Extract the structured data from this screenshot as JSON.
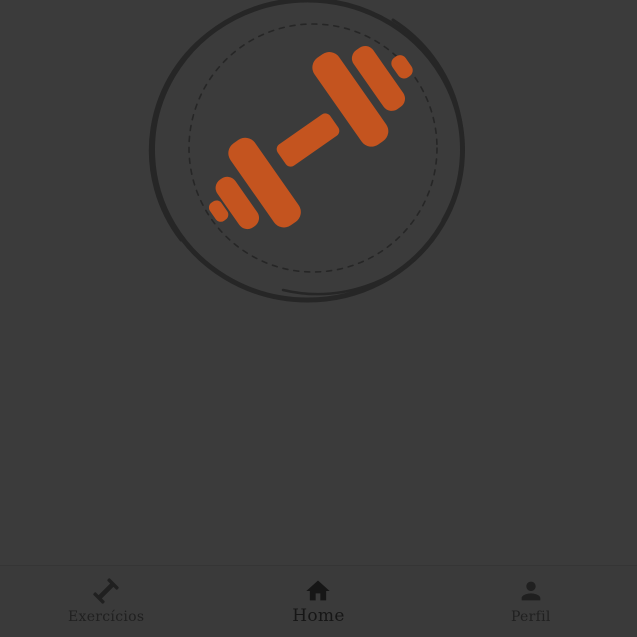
{
  "logo": {
    "icon": "dumbbell-icon",
    "dumbbell_color": "#c4541f",
    "ring_color": "#262626"
  },
  "nav": {
    "items": [
      {
        "label": "Exercícios",
        "icon": "dumbbell-small-icon",
        "active": false
      },
      {
        "label": "Home",
        "icon": "home-icon",
        "active": true
      },
      {
        "label": "Perfil",
        "icon": "person-icon",
        "active": false
      }
    ],
    "inactive_color": "#202020",
    "active_color": "#161616"
  }
}
